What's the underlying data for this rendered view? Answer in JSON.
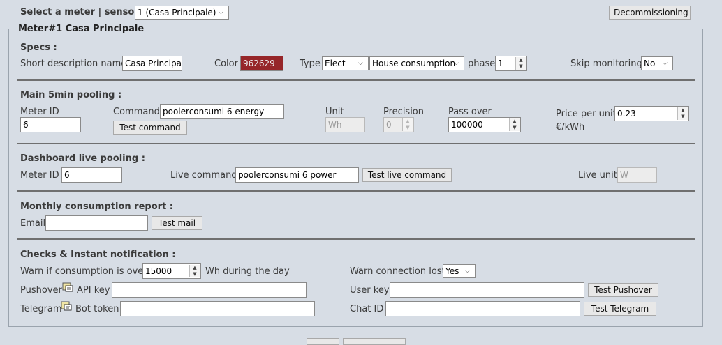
{
  "top": {
    "select_label": "Select a meter | sensor :",
    "meter_select_value": "1 (Casa Principale)",
    "decommission_label": "Decommissioning"
  },
  "meter": {
    "legend": "Meter#1 Casa Principale"
  },
  "specs": {
    "heading": "Specs :",
    "short_desc_label": "Short description name",
    "short_desc_value": "Casa Principal",
    "color_label": "Color",
    "color_value": "962629",
    "color_hex": "#962629",
    "type_label": "Type",
    "type_value": "Elect",
    "subtype_value": "House consumption",
    "phase_label": "phase",
    "phase_value": "1",
    "skip_label": "Skip monitoring",
    "skip_value": "No"
  },
  "main_pooling": {
    "heading": "Main 5min pooling :",
    "meter_id_label": "Meter ID",
    "meter_id_value": "6",
    "command_label": "Command",
    "command_value": "poolerconsumi 6 energy",
    "test_command_label": "Test command",
    "unit_label": "Unit",
    "unit_value": "Wh",
    "precision_label": "Precision",
    "precision_value": "0",
    "pass_over_label": "Pass over",
    "pass_over_value": "100000",
    "price_label": "Price per unit",
    "price_value": "0.23",
    "price_unit": "€/kWh"
  },
  "live_pooling": {
    "heading": "Dashboard live pooling :",
    "meter_id_label": "Meter ID",
    "meter_id_value": "6",
    "live_command_label": "Live command",
    "live_command_value": "poolerconsumi 6 power",
    "test_live_label": "Test live command",
    "live_unit_label": "Live unit",
    "live_unit_value": "W"
  },
  "monthly": {
    "heading": "Monthly consumption report :",
    "email_label": "Email",
    "email_value": "",
    "test_mail_label": "Test mail"
  },
  "checks": {
    "heading": "Checks & Instant notification :",
    "warn_label": "Warn if consumption is over",
    "warn_value": "15000",
    "warn_suffix": "Wh during the day",
    "warn_conn_label": "Warn connection lost",
    "warn_conn_value": "Yes",
    "pushover_label": "Pushover",
    "api_key_label": "API key",
    "api_key_value": "",
    "user_key_label": "User key",
    "user_key_value": "",
    "test_pushover_label": "Test Pushover",
    "telegram_label": "Telegram",
    "bot_token_label": "Bot token",
    "bot_token_value": "",
    "chat_id_label": "Chat ID",
    "chat_id_value": "",
    "test_telegram_label": "Test Telegram"
  },
  "icons": [
    "dropdown-arrow-icon",
    "spinner-arrows-icon",
    "help-popup-icon"
  ]
}
